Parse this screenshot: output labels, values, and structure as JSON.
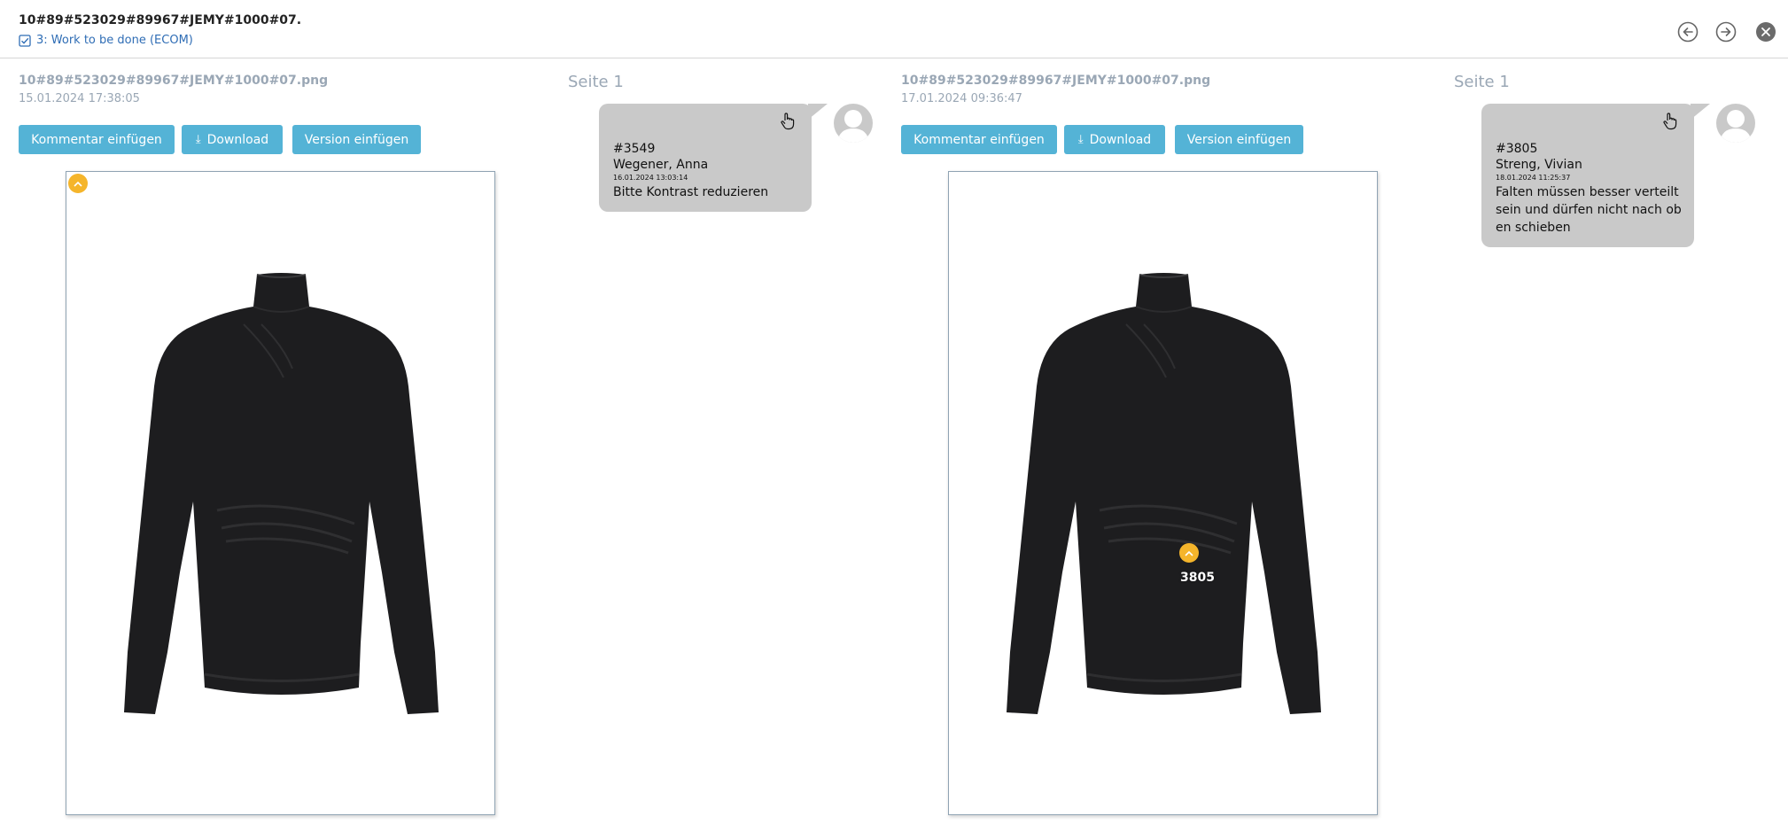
{
  "header": {
    "title": "10#89#523029#89967#JEMY#1000#07.",
    "status": "3: Work to be done (ECOM)"
  },
  "icons": {
    "back": "arrow-left-circle-icon",
    "forward": "arrow-right-circle-icon",
    "close": "close-circle-icon"
  },
  "colors": {
    "accent": "#54b3d6",
    "marker": "#f5b52b",
    "bubble": "#c9c9c9",
    "muted_text": "#9aa7b5"
  },
  "panels": [
    {
      "filename": "10#89#523029#89967#JEMY#1000#07.png",
      "date": "15.01.2024 17:38:05",
      "seite": "Seite 1",
      "buttons": {
        "comment": "Kommentar einfügen",
        "download": "Download",
        "version": "Version einfügen"
      },
      "comment": {
        "id": "#3549",
        "author": "Wegener, Anna",
        "timestamp": "16.01.2024 13:03:14",
        "text": "Bitte Kontrast reduzieren"
      }
    },
    {
      "filename": "10#89#523029#89967#JEMY#1000#07.png",
      "date": "17.01.2024 09:36:47",
      "seite": "Seite 1",
      "buttons": {
        "comment": "Kommentar einfügen",
        "download": "Download",
        "version": "Version einfügen"
      },
      "marker_label": "3805",
      "comment": {
        "id": "#3805",
        "author": "Streng, Vivian",
        "timestamp": "18.01.2024 11:25:37",
        "text": "Falten müssen besser verteilt sein und dürfen nicht nach oben schieben"
      }
    }
  ]
}
